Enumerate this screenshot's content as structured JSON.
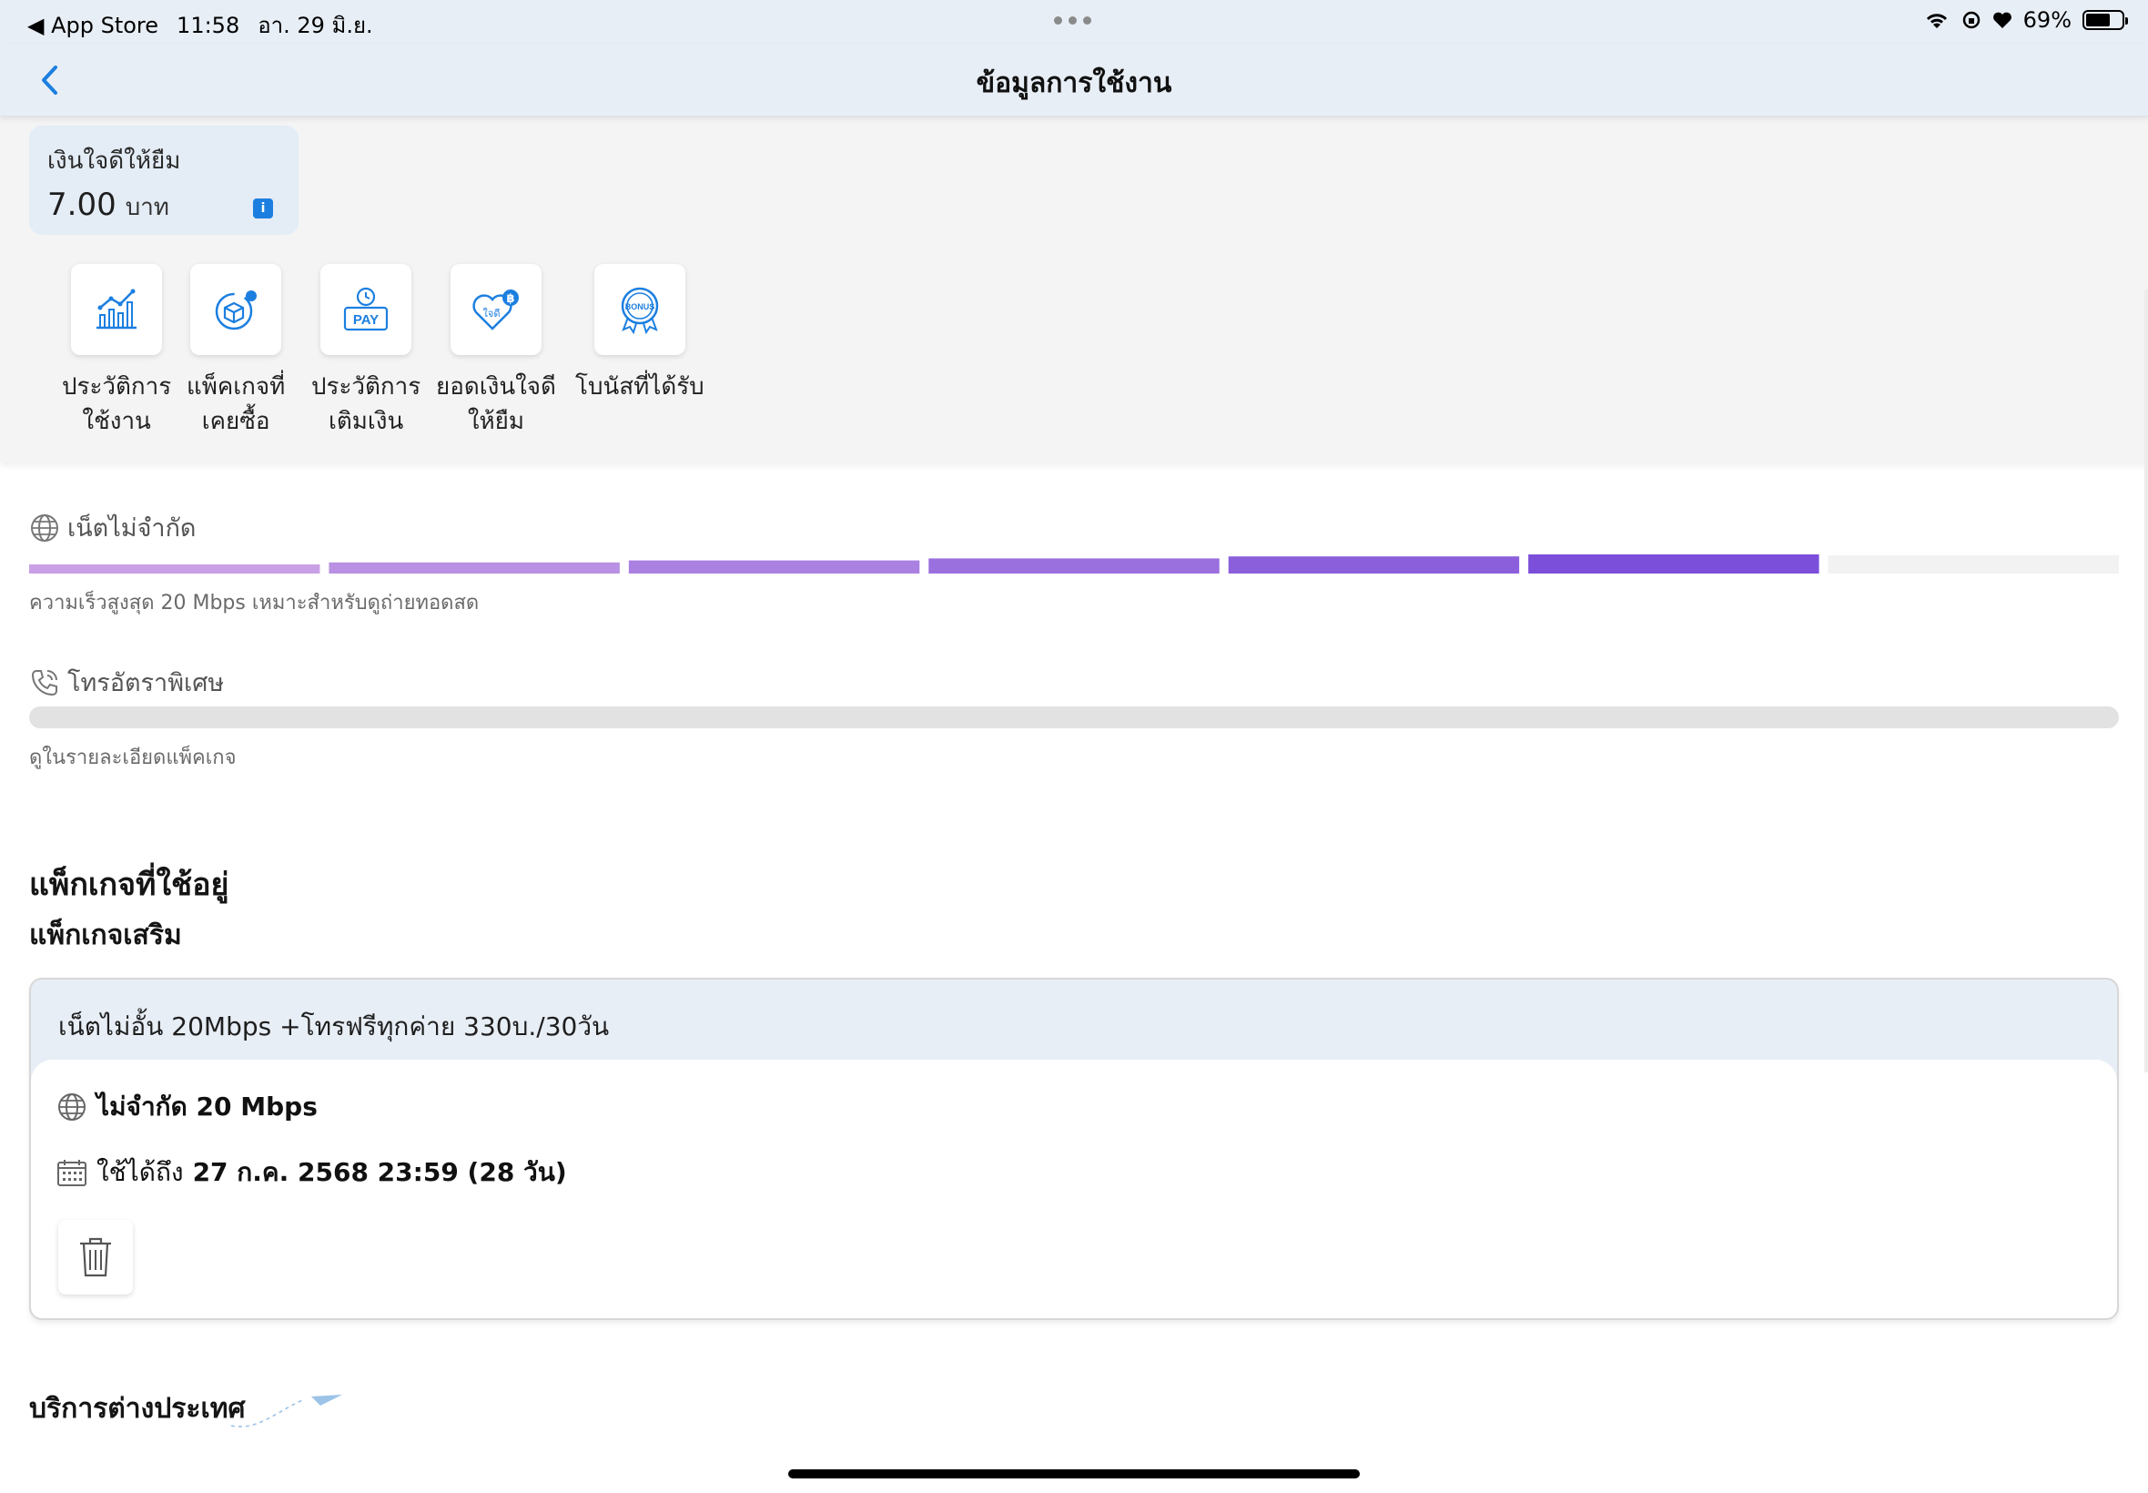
{
  "status_bar": {
    "back_app": "◀ App Store",
    "time": "11:58",
    "date": "อา. 29 มิ.ย.",
    "battery": "69%",
    "battery_level": 0.69
  },
  "nav": {
    "title": "ข้อมูลการใช้งาน"
  },
  "credit": {
    "label": "เงินใจดีให้ยืม",
    "amount": "7.00",
    "unit": "บาท",
    "info": "i"
  },
  "shortcuts": [
    {
      "line1": "ประวัติการ",
      "line2": "ใช้งาน",
      "icon": "chart-icon"
    },
    {
      "line1": "แพ็คเกจที่",
      "line2": "เคยซื้อ",
      "icon": "package-history-icon"
    },
    {
      "line1": "ประวัติการ",
      "line2": "เติมเงิน",
      "icon": "pay-history-icon"
    },
    {
      "line1": "ยอดเงินใจดี",
      "line2": "ให้ยืม",
      "icon": "heart-loan-icon"
    },
    {
      "line1": "โบนัสที่ได้รับ",
      "line2": "",
      "icon": "bonus-icon",
      "badge": "BONUS"
    }
  ],
  "icon_texts": {
    "pay": "PAY",
    "heart": "ใจดี",
    "baht": "฿"
  },
  "internet": {
    "label": "เน็ตไม่จำกัด",
    "note": "ความเร็วสูงสุด 20 Mbps เหมาะสำหรับดูถ่ายทอดสด",
    "segments_filled": 6,
    "segments_total": 7
  },
  "call": {
    "label": "โทรอัตราพิเศษ",
    "note": "ดูในรายละเอียดแพ็คเกจ"
  },
  "active": {
    "heading": "แพ็กเกจที่ใช้อยู่",
    "subheading": "แพ็กเกจเสริม"
  },
  "package": {
    "name": "เน็ตไม่อั้น 20Mbps +โทรฟรีทุกค่าย 330บ./30วัน",
    "speed": "ไม่จำกัด 20 Mbps",
    "valid_prefix": "ใช้ได้ถึง",
    "valid_until": "27 ก.ค. 2568 23:59 (28 วัน)"
  },
  "international": {
    "heading": "บริการต่างประเทศ"
  },
  "colors": {
    "accent_blue": "#1c7fe0",
    "purple_start": "#c9a0e6",
    "purple_end": "#7b4fd9",
    "header_bg": "#e8eef6"
  }
}
